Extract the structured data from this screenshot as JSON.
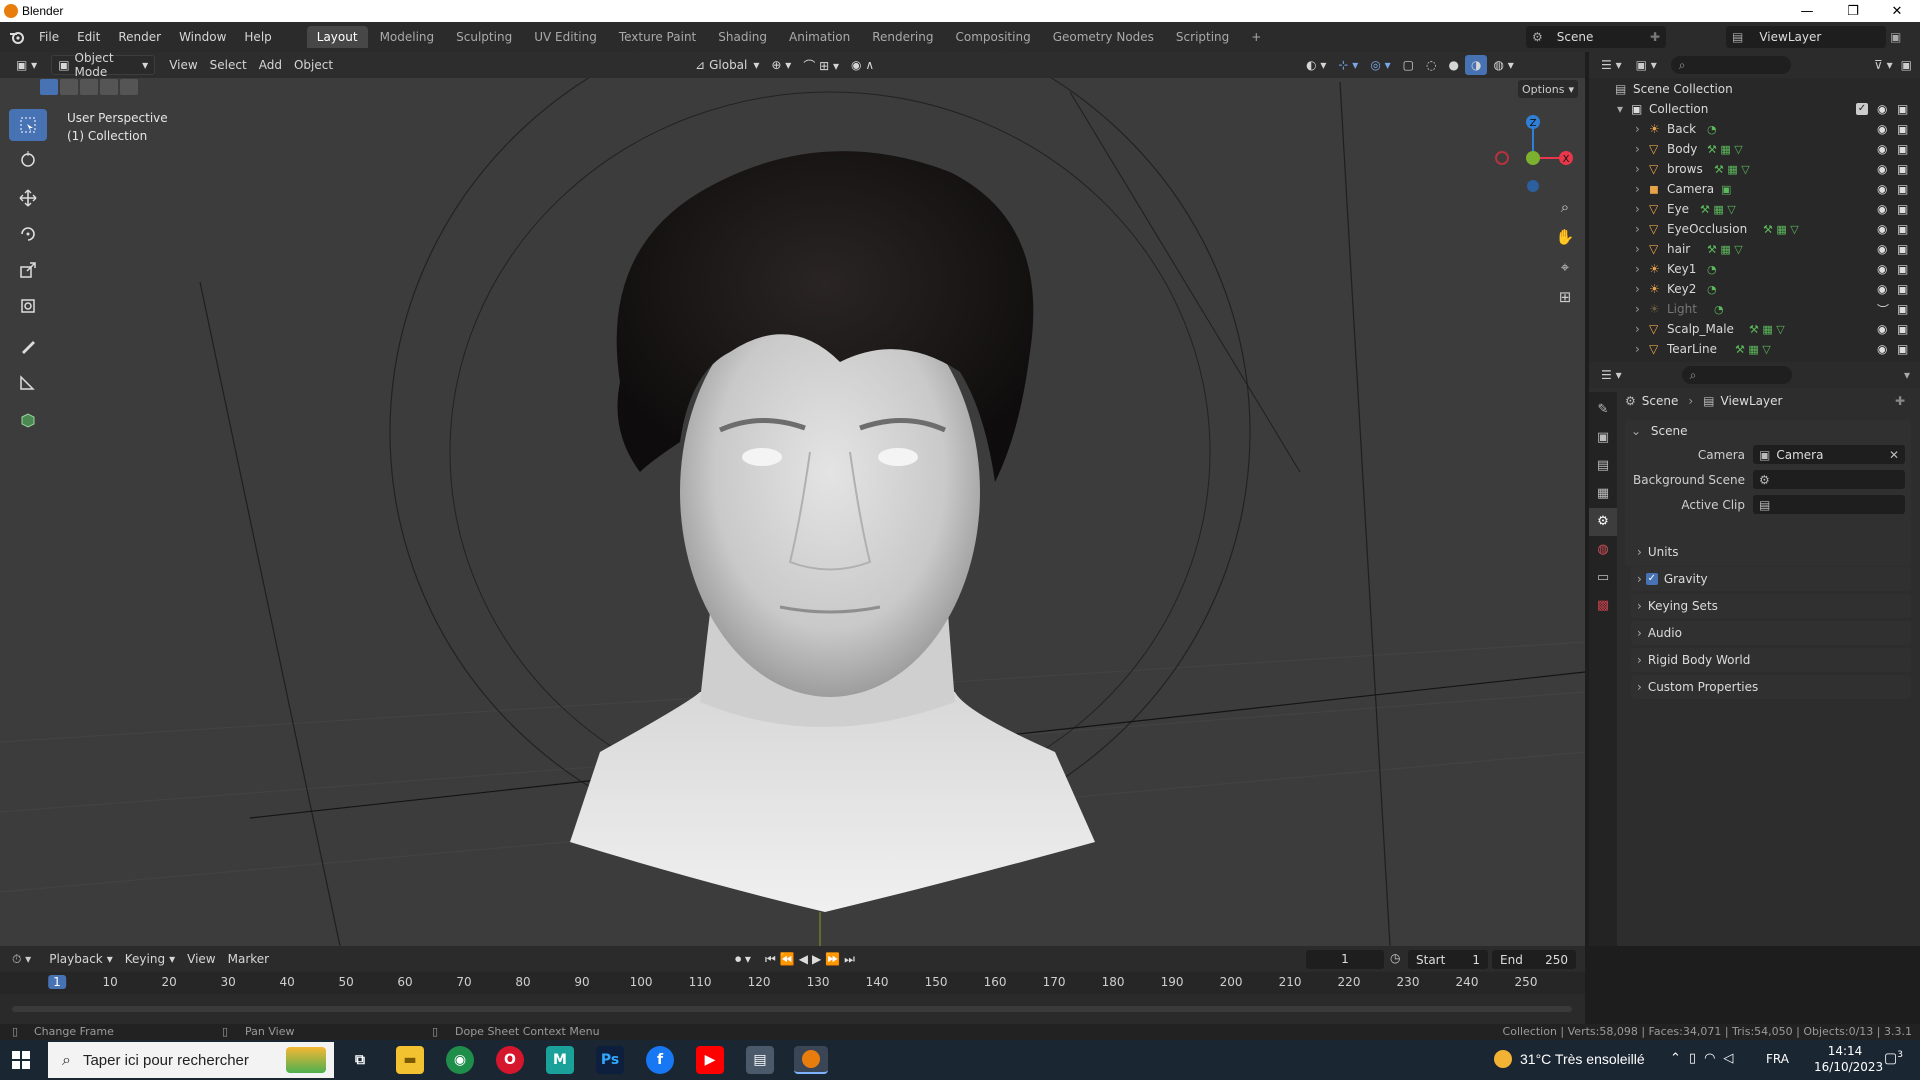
{
  "window": {
    "title": "Blender",
    "min": "—",
    "max": "❐",
    "close": "✕"
  },
  "menu": [
    "File",
    "Edit",
    "Render",
    "Window",
    "Help"
  ],
  "workspaces": [
    "Layout",
    "Modeling",
    "Sculpting",
    "UV Editing",
    "Texture Paint",
    "Shading",
    "Animation",
    "Rendering",
    "Compositing",
    "Geometry Nodes",
    "Scripting"
  ],
  "active_workspace": "Layout",
  "add_tab": "+",
  "scene_field": "Scene",
  "viewlayer_field": "ViewLayer",
  "viewport": {
    "mode": "Object Mode",
    "menus": [
      "View",
      "Select",
      "Add",
      "Object"
    ],
    "orientation": "Global",
    "options": "Options",
    "overlay_line1": "User Perspective",
    "overlay_line2": "(1) Collection",
    "gizmo": {
      "z": "Z",
      "x": "X",
      "y": "Y"
    }
  },
  "outliner": {
    "root": "Scene Collection",
    "collection": "Collection",
    "items": [
      {
        "name": "Back",
        "type": "light",
        "dim": false
      },
      {
        "name": "Body",
        "type": "mesh",
        "dim": false
      },
      {
        "name": "brows",
        "type": "mesh",
        "dim": false
      },
      {
        "name": "Camera",
        "type": "camera",
        "dim": false
      },
      {
        "name": "Eye",
        "type": "mesh",
        "dim": false
      },
      {
        "name": "EyeOcclusion",
        "type": "mesh",
        "dim": false
      },
      {
        "name": "hair",
        "type": "mesh",
        "dim": false
      },
      {
        "name": "Key1",
        "type": "light",
        "dim": false
      },
      {
        "name": "Key2",
        "type": "light",
        "dim": false
      },
      {
        "name": "Light",
        "type": "light",
        "dim": true
      },
      {
        "name": "Scalp_Male",
        "type": "mesh",
        "dim": false
      },
      {
        "name": "TearLine",
        "type": "mesh",
        "dim": false
      }
    ]
  },
  "properties": {
    "breadcrumb_scene": "Scene",
    "breadcrumb_sep": "›",
    "breadcrumb_viewlayer": "ViewLayer",
    "panel_title": "Scene",
    "camera_label": "Camera",
    "camera_value": "Camera",
    "bg_scene_label": "Background Scene",
    "active_clip_label": "Active Clip",
    "subpanels": [
      "Units",
      "Gravity",
      "Keying Sets",
      "Audio",
      "Rigid Body World",
      "Custom Properties"
    ],
    "gravity_checked": true
  },
  "timeline": {
    "menus": [
      "Playback",
      "Keying",
      "View",
      "Marker"
    ],
    "current_frame": "1",
    "start_label": "Start",
    "start_value": "1",
    "end_label": "End",
    "end_value": "250",
    "ticks": [
      "1",
      "10",
      "20",
      "30",
      "40",
      "50",
      "60",
      "70",
      "80",
      "90",
      "100",
      "110",
      "120",
      "130",
      "140",
      "150",
      "160",
      "170",
      "180",
      "190",
      "200",
      "210",
      "220",
      "230",
      "240",
      "250"
    ]
  },
  "status": {
    "change_frame": "Change Frame",
    "pan_view": "Pan View",
    "context_menu": "Dope Sheet Context Menu",
    "stats": "Collection | Verts:58,098 | Faces:34,071 | Tris:54,050 | Objects:0/13 | 3.3.1"
  },
  "taskbar": {
    "search_placeholder": "Taper ici pour rechercher",
    "weather": "31°C  Très ensoleillé",
    "lang": "FRA",
    "time": "14:14",
    "date": "16/10/2023",
    "notif_count": "3"
  },
  "colors": {
    "accent": "#4772b3",
    "blender_orange": "#e87d0d",
    "axis_x": "#e8374a",
    "axis_y": "#7cb12f",
    "axis_z": "#2f7fd6"
  }
}
